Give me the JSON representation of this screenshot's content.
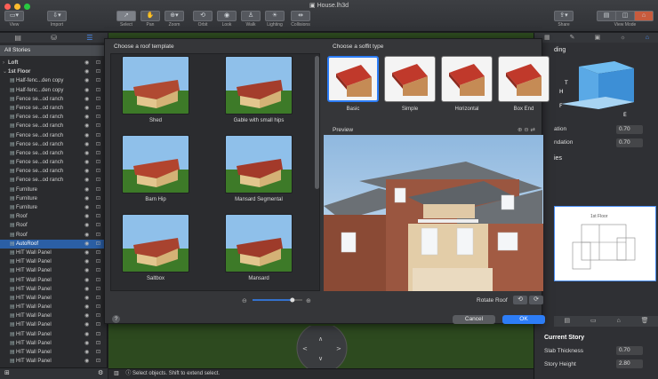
{
  "window": {
    "title": "House.lh3d"
  },
  "toolbar": {
    "view": "View",
    "import": "Import",
    "select": "Select",
    "pan": "Pan",
    "zoom": "Zoom",
    "orbit": "Orbit",
    "look": "Look",
    "walk": "Walk",
    "lighting": "Lighting",
    "collisions": "Collisions",
    "share": "Share",
    "view_mode": "View Mode"
  },
  "left": {
    "stories_header": "All Stories",
    "tree": [
      {
        "label": "Loft",
        "level": 0
      },
      {
        "label": "1st Floor",
        "level": 0
      },
      {
        "label": "Half-fenc...den copy",
        "level": 1
      },
      {
        "label": "Half-fenc...den copy",
        "level": 1
      },
      {
        "label": "Fence se...od ranch",
        "level": 1
      },
      {
        "label": "Fence se...od ranch",
        "level": 1
      },
      {
        "label": "Fence se...od ranch",
        "level": 1
      },
      {
        "label": "Fence se...od ranch",
        "level": 1
      },
      {
        "label": "Fence se...od ranch",
        "level": 1
      },
      {
        "label": "Fence se...od ranch",
        "level": 1
      },
      {
        "label": "Fence se...od ranch",
        "level": 1
      },
      {
        "label": "Fence se...od ranch",
        "level": 1
      },
      {
        "label": "Fence se...od ranch",
        "level": 1
      },
      {
        "label": "Fence se...od ranch",
        "level": 1
      },
      {
        "label": "Furniture",
        "level": 1
      },
      {
        "label": "Furniture",
        "level": 1
      },
      {
        "label": "Furniture",
        "level": 1
      },
      {
        "label": "Roof",
        "level": 1
      },
      {
        "label": "Roof",
        "level": 1
      },
      {
        "label": "Roof",
        "level": 1
      },
      {
        "label": "AutoRoof",
        "level": 1,
        "selected": true
      },
      {
        "label": "HIT Wall Panel",
        "level": 1
      },
      {
        "label": "HIT Wall Panel",
        "level": 1
      },
      {
        "label": "HIT Wall Panel",
        "level": 1
      },
      {
        "label": "HIT Wall Panel",
        "level": 1
      },
      {
        "label": "HIT Wall Panel",
        "level": 1
      },
      {
        "label": "HIT Wall Panel",
        "level": 1
      },
      {
        "label": "HIT Wall Panel",
        "level": 1
      },
      {
        "label": "HIT Wall Panel",
        "level": 1
      },
      {
        "label": "HIT Wall Panel",
        "level": 1
      },
      {
        "label": "HIT Wall Panel",
        "level": 1
      },
      {
        "label": "HIT Wall Panel",
        "level": 1
      },
      {
        "label": "HIT Wall Panel",
        "level": 1
      },
      {
        "label": "HIT Wall Panel",
        "level": 1
      }
    ]
  },
  "dialog": {
    "roof_header": "Choose a roof template",
    "templates": [
      "Shed",
      "Gable with small hips",
      "Barn Hip",
      "Mansard Segmental",
      "Saltbox",
      "Mansard"
    ],
    "soffit_header": "Choose a soffit type",
    "soffits": [
      "Basic",
      "Simple",
      "Horizontal",
      "Box End"
    ],
    "preview_label": "Preview",
    "rotate_label": "Rotate Roof",
    "help": "?",
    "cancel": "Cancel",
    "ok": "OK",
    "slider_value": 0.8
  },
  "right": {
    "header_fragment": "ding",
    "row1_label": "ation",
    "row1_value": "0.70",
    "row2_label": "ndation",
    "row2_value": "0.70",
    "section_fragment": "ies",
    "story_header": "Current Story",
    "slab_label": "Slab Thickness",
    "slab_value": "0.70",
    "height_label": "Story Height",
    "height_value": "2.80",
    "plan_label": "1st Floor"
  },
  "status": {
    "text": "Select objects. Shift to extend select."
  },
  "colors": {
    "accent": "#2d7df6",
    "selected_row": "#2b5fa5"
  }
}
